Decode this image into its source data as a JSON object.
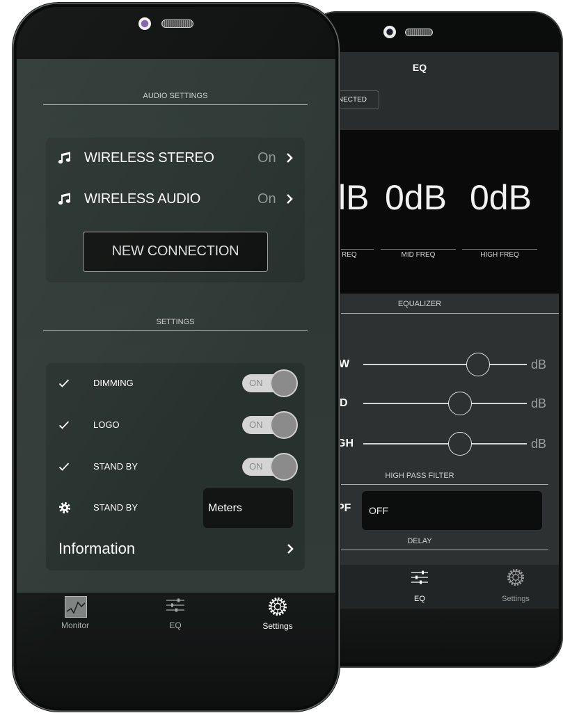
{
  "front_phone": {
    "audio_settings": {
      "section_title": "AUDIO SETTINGS",
      "rows": [
        {
          "icon": "music-note-icon",
          "label": "WIRELESS STEREO",
          "value": "On"
        },
        {
          "icon": "music-note-icon",
          "label": "WIRELESS AUDIO",
          "value": "On"
        }
      ],
      "new_connection_label": "NEW CONNECTION"
    },
    "settings": {
      "section_title": "SETTINGS",
      "toggles": [
        {
          "icon": "check-icon",
          "label": "DIMMING",
          "state": "ON"
        },
        {
          "icon": "check-icon",
          "label": "LOGO",
          "state": "ON"
        },
        {
          "icon": "check-icon",
          "label": "STAND BY",
          "state": "ON"
        }
      ],
      "standby_select": {
        "icon": "gear-icon",
        "label": "STAND BY",
        "value": "Meters"
      },
      "information_label": "Information"
    },
    "bottom_nav": [
      {
        "icon": "monitor-icon",
        "label": "Monitor",
        "active": false
      },
      {
        "icon": "eq-sliders-icon",
        "label": "EQ",
        "active": false
      },
      {
        "icon": "settings-gear-icon",
        "label": "Settings",
        "active": true
      }
    ]
  },
  "back_phone": {
    "header_title": "EQ",
    "connection_button_label": "NECTED",
    "gain_readouts": [
      "lB",
      "0dB",
      "0dB"
    ],
    "band_labels": [
      "REQ",
      "MID FREQ",
      "HIGH FREQ"
    ],
    "equalizer": {
      "section_title": "EQUALIZER",
      "bands": [
        {
          "label": "W",
          "unit": "dB",
          "level": 0.7
        },
        {
          "label": "D",
          "unit": "dB",
          "level": 0.59
        },
        {
          "label": "GH",
          "unit": "dB",
          "level": 0.59
        }
      ]
    },
    "high_pass_filter": {
      "section_title": "HIGH PASS FILTER",
      "label": "PF",
      "value": "OFF"
    },
    "delay": {
      "section_title": "DELAY"
    },
    "bottom_nav": [
      {
        "icon": "eq-sliders-icon",
        "label": "EQ",
        "active": true
      },
      {
        "icon": "settings-gear-icon",
        "label": "Settings",
        "active": false
      }
    ]
  },
  "colors": {
    "screen_background": "#2f3935",
    "card_background": "#27312d",
    "eq_background": "#2e3131",
    "active_nav_label": "#ffffff",
    "inactive_nav_label": "#a9adab",
    "toggle_track": "#d4d4d4",
    "toggle_knob": "#8b8b8b"
  }
}
